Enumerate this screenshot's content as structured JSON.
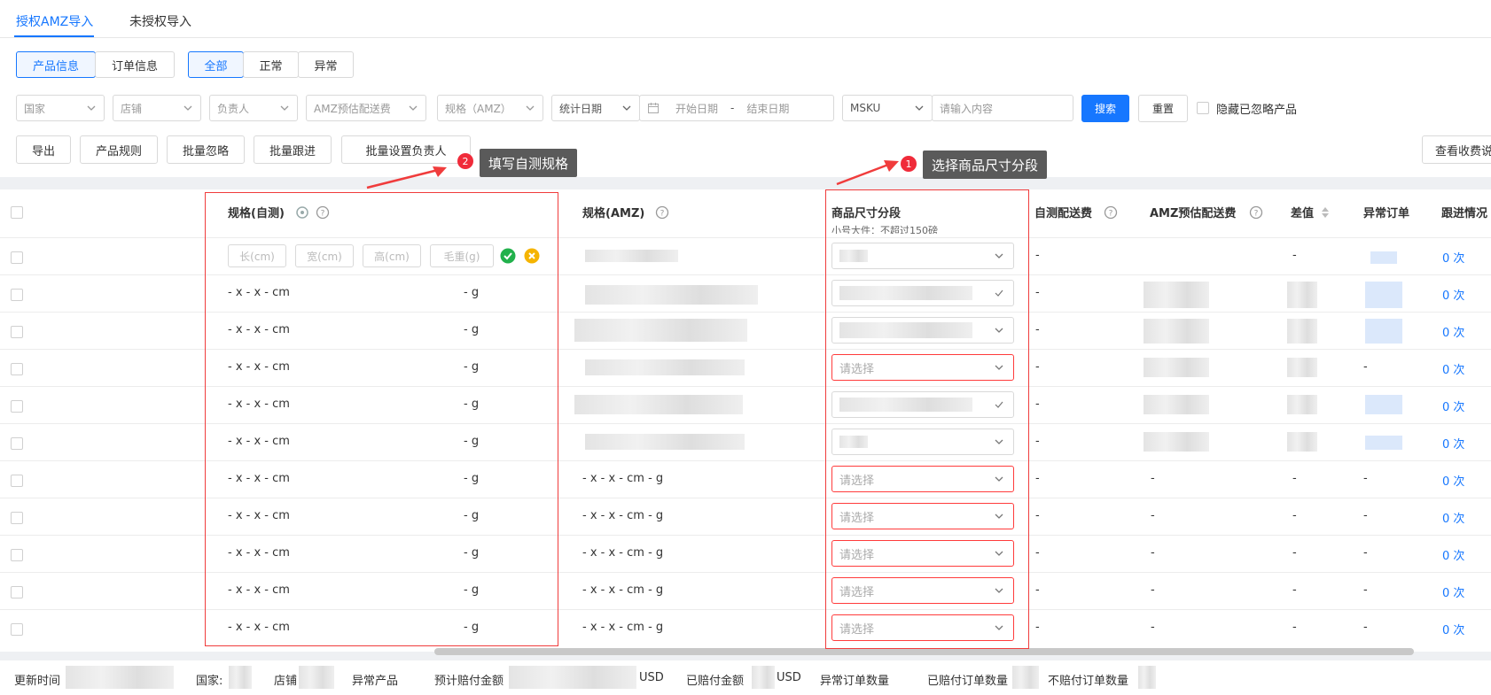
{
  "tabs": [
    "授权AMZ导入",
    "未授权导入"
  ],
  "info_segment": [
    "产品信息",
    "订单信息"
  ],
  "status_segment": [
    "全部",
    "正常",
    "异常"
  ],
  "filters": {
    "country": "国家",
    "store": "店铺",
    "owner": "负责人",
    "amz_fee": "AMZ预估配送费",
    "spec": "规格（AMZ）",
    "stat_date": "统计日期",
    "start_date": "开始日期",
    "date_sep": "-",
    "end_date": "结束日期",
    "field": "MSKU",
    "search_placeholder": "请输入内容",
    "search_btn": "搜索",
    "reset_btn": "重置",
    "hide_ignored": "隐藏已忽略产品"
  },
  "actions": [
    "导出",
    "产品规则",
    "批量忽略",
    "批量跟进",
    "批量设置负责人"
  ],
  "right_action": "查看收费说",
  "callouts": {
    "one": {
      "num": "1",
      "text": "选择商品尺寸分段"
    },
    "two": {
      "num": "2",
      "text": "填写自测规格"
    }
  },
  "columns": {
    "spec_self": "规格(自测)",
    "spec_amz": "规格(AMZ)",
    "size_tier": "商品尺寸分段",
    "self_fee": "自测配送费",
    "amz_fee": "AMZ预估配送费",
    "diff": "差值",
    "abnormal": "异常订单",
    "follow": "跟进情况"
  },
  "edit_row": {
    "length": "长(cm)",
    "width": "宽(cm)",
    "height": "高(cm)",
    "weight": "毛重(g)",
    "tier_peek": "小号大件：不超过150磅"
  },
  "rows": [
    {
      "self_dim": "-   x -   x -   cm",
      "self_w": "- g",
      "amz": "",
      "tier": "",
      "self_fee": "-",
      "amz_fee": "",
      "diff": "",
      "abn": "",
      "follow": "0 次"
    },
    {
      "self_dim": "-   x -   x -   cm",
      "self_w": "- g",
      "amz": "",
      "tier": "",
      "self_fee": "-",
      "amz_fee": "",
      "diff": "",
      "abn": "",
      "follow": "0 次"
    },
    {
      "self_dim": "-   x -   x -   cm",
      "self_w": "- g",
      "amz": "",
      "tier": "请选择",
      "self_fee": "-",
      "amz_fee": "",
      "diff": "",
      "abn": "-",
      "follow": "0 次"
    },
    {
      "self_dim": "-   x -   x -   cm",
      "self_w": "- g",
      "amz": "",
      "tier": "",
      "self_fee": "-",
      "amz_fee": "",
      "diff": "",
      "abn": "",
      "follow": "0 次"
    },
    {
      "self_dim": "-   x -   x -   cm",
      "self_w": "- g",
      "amz": "",
      "tier": "",
      "self_fee": "-",
      "amz_fee": "",
      "diff": "",
      "abn": "",
      "follow": "0 次"
    },
    {
      "self_dim": "-   x -   x -   cm",
      "self_w": "- g",
      "amz": "- x - x - cm - g",
      "tier": "请选择",
      "self_fee": "-",
      "amz_fee": "-",
      "diff": "-",
      "abn": "-",
      "follow": "0 次"
    },
    {
      "self_dim": "-   x -   x -   cm",
      "self_w": "- g",
      "amz": "- x - x - cm - g",
      "tier": "请选择",
      "self_fee": "-",
      "amz_fee": "-",
      "diff": "-",
      "abn": "-",
      "follow": "0 次"
    },
    {
      "self_dim": "-   x -   x -   cm",
      "self_w": "- g",
      "amz": "- x - x - cm - g",
      "tier": "请选择",
      "self_fee": "-",
      "amz_fee": "-",
      "diff": "-",
      "abn": "-",
      "follow": "0 次"
    },
    {
      "self_dim": "-   x -   x -   cm",
      "self_w": "- g",
      "amz": "- x - x - cm - g",
      "tier": "请选择",
      "self_fee": "-",
      "amz_fee": "-",
      "diff": "-",
      "abn": "-",
      "follow": "0 次"
    },
    {
      "self_dim": "-   x -   x -   cm",
      "self_w": "- g",
      "amz": "- x - x - cm - g",
      "tier": "请选择",
      "self_fee": "-",
      "amz_fee": "-",
      "diff": "-",
      "abn": "-",
      "follow": "0 次"
    }
  ],
  "edit_row_values": {
    "self_fee": "-",
    "diff": "-",
    "follow": "0 次"
  },
  "footer": {
    "update_time": "更新时间",
    "country": "国家:",
    "store": "店铺",
    "abnormal_products": "异常产品",
    "est_compensation": "预计赔付金额",
    "usd1": "USD",
    "paid_amount": "已赔付金额",
    "usd2": "USD",
    "abnormal_orders": "异常订单数量",
    "paid_orders": "已赔付订单数量",
    "unpaid_orders": "不赔付订单数量"
  }
}
